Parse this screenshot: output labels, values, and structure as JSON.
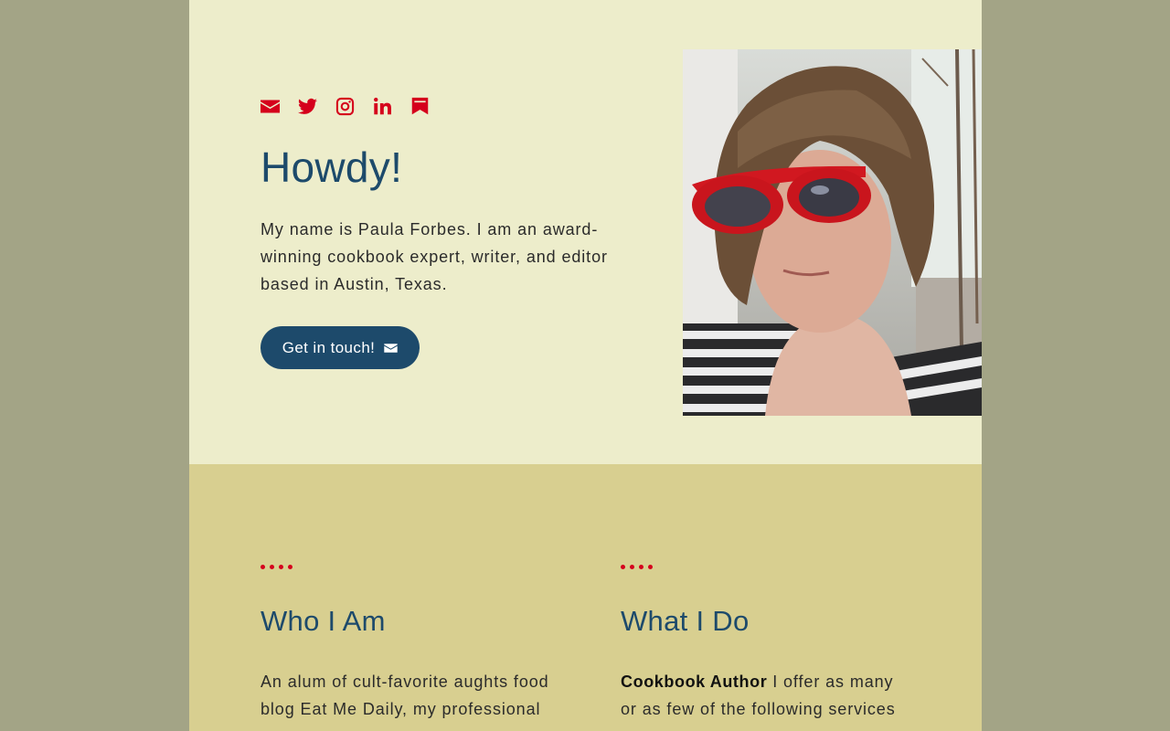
{
  "hero": {
    "heading": "Howdy!",
    "intro": "My name is Paula Forbes. I am an award-winning cookbook expert, writer, and editor based in Austin, Texas.",
    "cta_label": "Get in touch!",
    "social": [
      {
        "name": "email-icon"
      },
      {
        "name": "twitter-icon"
      },
      {
        "name": "instagram-icon"
      },
      {
        "name": "linkedin-icon"
      },
      {
        "name": "bookmark-icon"
      }
    ],
    "photo_alt": "Paula Forbes"
  },
  "about": {
    "who": {
      "heading": "Who I Am",
      "text": "An alum of cult-favorite aughts food blog Eat Me Daily, my professional"
    },
    "what": {
      "heading": "What I Do",
      "lead": "Cookbook Author",
      "text": " I offer as many or as few of the following services as"
    }
  },
  "colors": {
    "accent_red": "#d5001c",
    "navy": "#1d4a6b",
    "hero_bg": "#ededcb",
    "about_bg": "#d8cf90",
    "outer_bg": "#a3a486"
  }
}
